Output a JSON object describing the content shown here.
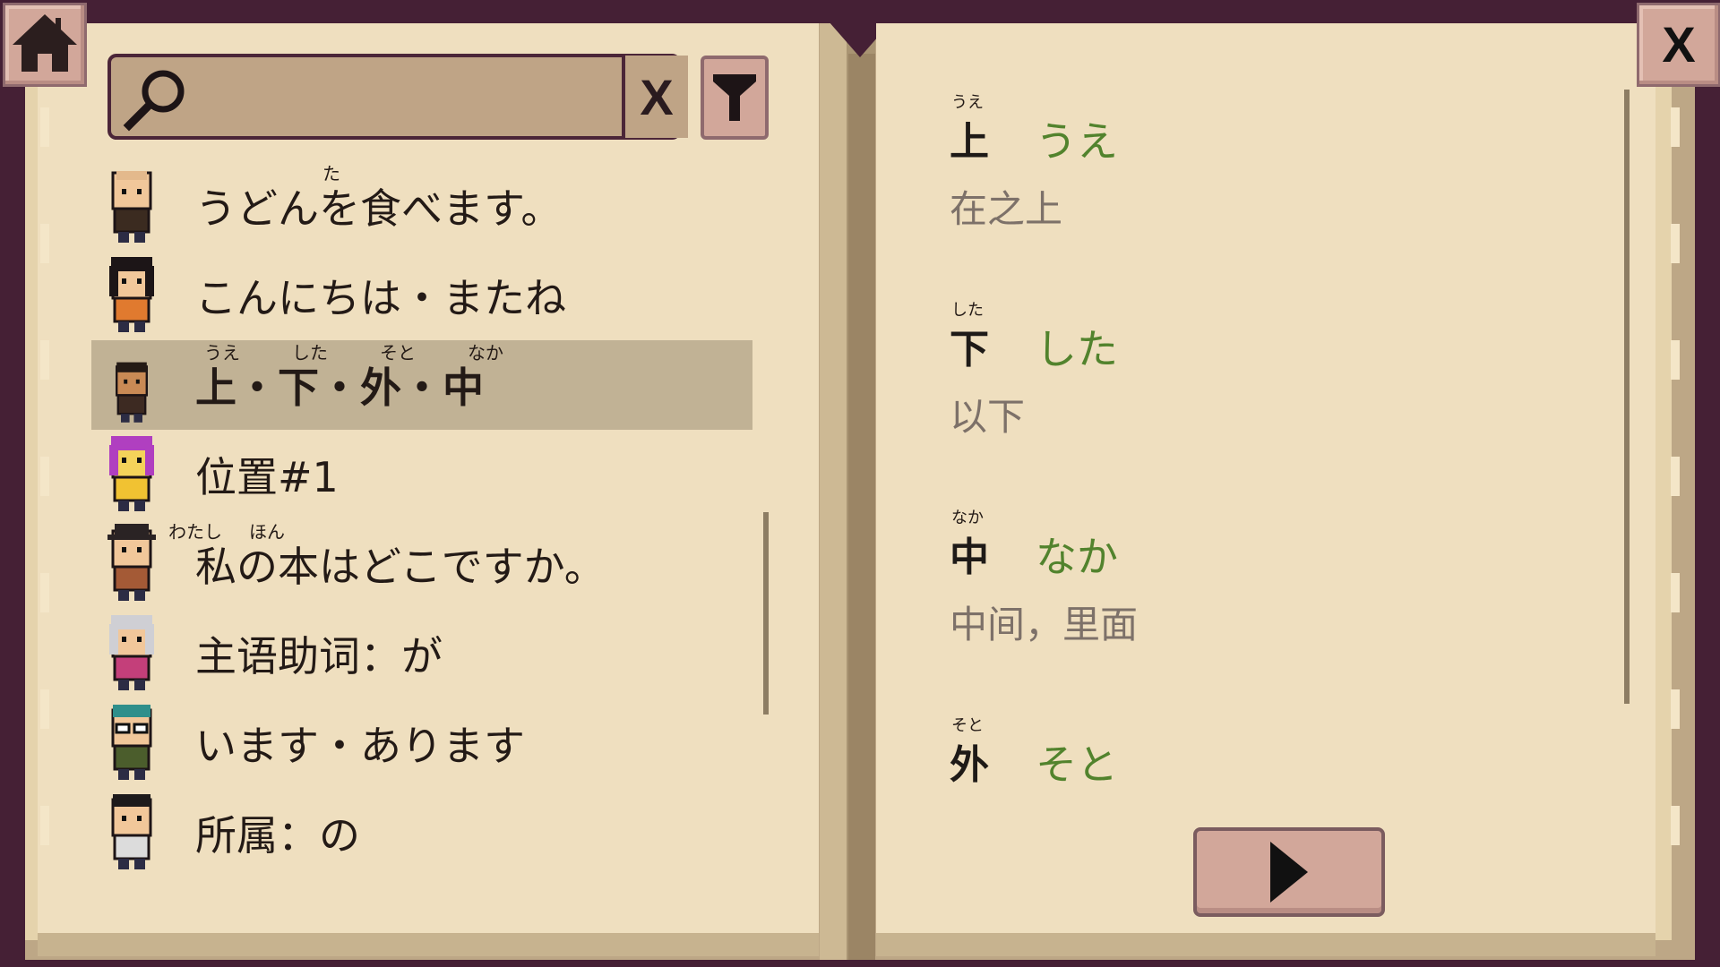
{
  "search": {
    "value": "",
    "placeholder": ""
  },
  "lessons": [
    {
      "title": "うどんを食べます。",
      "ruby": [
        {
          "text": "た",
          "at": "食"
        }
      ],
      "bold": false,
      "selected": false,
      "avatar": "bald-man-avatar"
    },
    {
      "title": "こんにちは・またね",
      "ruby": [],
      "bold": false,
      "selected": false,
      "avatar": "black-hair-girl-avatar"
    },
    {
      "title": "上・下・外・中",
      "ruby": [
        {
          "text": "うえ"
        },
        {
          "text": "した"
        },
        {
          "text": "そと"
        },
        {
          "text": "なか"
        }
      ],
      "bold": true,
      "selected": true,
      "avatar": "small-boy-avatar"
    },
    {
      "title": "位置#1",
      "ruby": [],
      "bold": false,
      "selected": false,
      "avatar": "purple-hair-avatar"
    },
    {
      "title": "私の本はどこですか。",
      "ruby": [
        {
          "text": "わたし"
        },
        {
          "text": "ほん"
        }
      ],
      "bold": false,
      "selected": false,
      "avatar": "hat-man-avatar"
    },
    {
      "title": "主语助词：が",
      "ruby": [],
      "bold": false,
      "selected": false,
      "avatar": "grandma-avatar"
    },
    {
      "title": "います・あります",
      "ruby": [],
      "bold": false,
      "selected": false,
      "avatar": "teal-hair-glasses-avatar"
    },
    {
      "title": "所属：の",
      "ruby": [],
      "bold": false,
      "selected": false,
      "avatar": "old-man-avatar"
    }
  ],
  "entries": [
    {
      "kanji": "上",
      "furigana": "うえ",
      "reading": "うえ",
      "meaning": "在之上"
    },
    {
      "kanji": "下",
      "furigana": "した",
      "reading": "した",
      "meaning": "以下"
    },
    {
      "kanji": "中",
      "furigana": "なか",
      "reading": "なか",
      "meaning": "中间，里面"
    },
    {
      "kanji": "外",
      "furigana": "そと",
      "reading": "そと",
      "meaning": ""
    }
  ],
  "buttons": {
    "close_label": "X",
    "clear_label": "X"
  },
  "icons": {
    "home": "home-icon",
    "search": "magnifier-icon",
    "filter": "funnel-icon",
    "next": "play-arrow-icon"
  },
  "colors": {
    "background": "#452035",
    "page": "#efdfbf",
    "selected_row": "#c1b295",
    "reading_text": "#52832d",
    "meaning_text": "#7d7169",
    "button": "#d2a79a"
  }
}
